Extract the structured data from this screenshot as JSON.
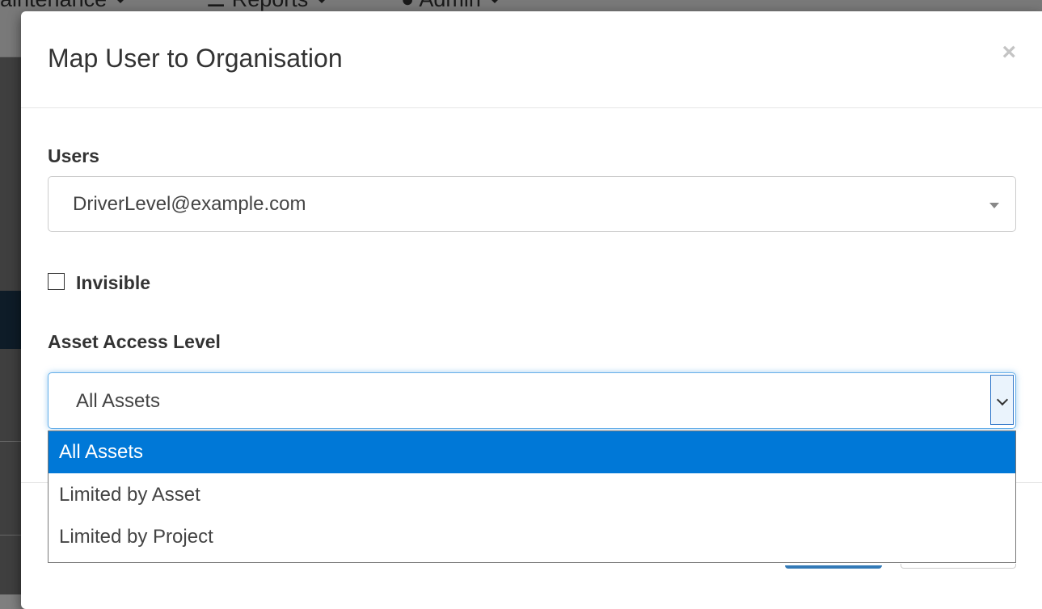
{
  "background": {
    "nav_items": [
      "aintenance",
      "Reports",
      "Admin"
    ]
  },
  "modal": {
    "title": "Map User to Organisation",
    "close_symbol": "×"
  },
  "users_field": {
    "label": "Users",
    "value": "DriverLevel@example.com"
  },
  "invisible_checkbox": {
    "label": "Invisible",
    "checked": false
  },
  "asset_access": {
    "label": "Asset Access Level",
    "value": "All Assets",
    "options": [
      "All Assets",
      "Limited by Asset",
      "Limited by Project"
    ],
    "selected_index": 0
  },
  "colors": {
    "option_highlight": "#0078d7",
    "focus_border": "#66afe9",
    "primary_button": "#337ab7"
  }
}
